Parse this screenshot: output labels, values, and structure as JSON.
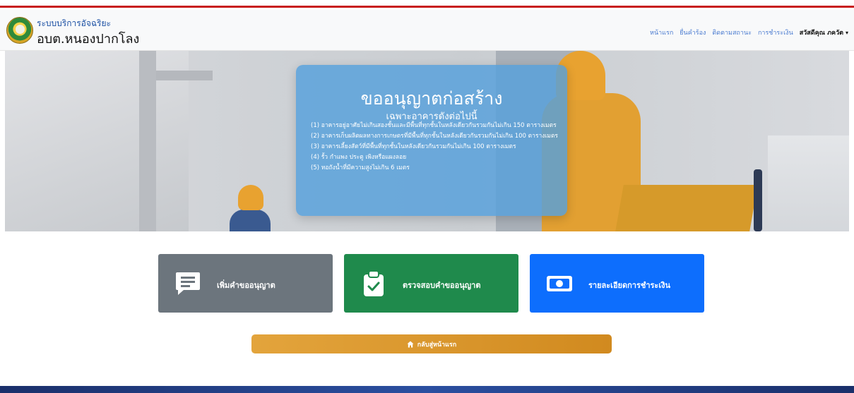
{
  "header": {
    "brand_subtitle": "ระบบบริการอัจฉริยะ",
    "brand_title": "อบต.หนองปากโลง",
    "nav": {
      "home": "หน้าแรก",
      "submit": "ยื่นคำร้อง",
      "track": "ติดตามสถานะ",
      "payment": "การชำระเงิน",
      "user": "สวัสดีคุณ ภควัต"
    },
    "colors": {
      "top_accent": "#c81c1c",
      "link": "#4a7bd0"
    }
  },
  "hero": {
    "title": "ขออนุญาตก่อสร้าง",
    "subtitle": "เฉพาะอาคารดังต่อไปนี้",
    "items": [
      "(1) อาคารอยู่อาศัยไม่เกินสองชั้นและมีพื้นที่ทุกชั้นในหลังเดียวกันรวมกันไม่เกิน 150 ตารางเมตร",
      "(2) อาคารเก็บผลิตผลทางการเกษตรที่มีพื้นที่ทุกชั้นในหลังเดียวกันรวมกันไม่เกิน 100 ตารางเมตร",
      "(3) อาคารเลี้ยงสัตว์ที่มีพื้นที่ทุกชั้นในหลังเดียวกันรวมกันไม่เกิน 100 ตารางเมตร",
      "(4) รั้ว กำแพง ประตู เพิงหรือแผงลอย",
      "(5) หอถังน้ำที่มีความสูงไม่เกิน 6 เมตร"
    ]
  },
  "actions": {
    "add_request": {
      "label": "เพิ่มคำขออนุญาต",
      "icon": "message-icon",
      "color": "#6c757d"
    },
    "check_request": {
      "label": "ตรวจสอบคำขออนุญาต",
      "icon": "clipboard-check-icon",
      "color": "#1f8a4c"
    },
    "payment_details": {
      "label": "รายละเอียดการชำระเงิน",
      "icon": "banknote-icon",
      "color": "#0d6efd"
    }
  },
  "back_button": {
    "label": "กลับสู่หน้าแรก",
    "icon": "home-icon"
  }
}
